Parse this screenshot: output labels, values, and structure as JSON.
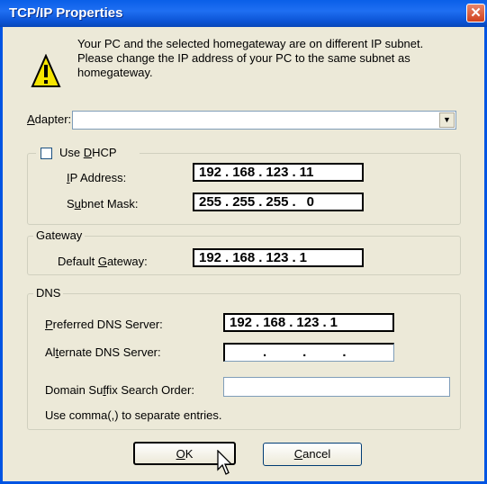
{
  "window": {
    "title": "TCP/IP Properties",
    "close_label": "✕"
  },
  "message": {
    "line1": "Your PC and the selected homegateway are on different IP subnet.",
    "line2": "Please change the IP address of your PC to the same subnet as",
    "line3": "homegateway."
  },
  "adapter": {
    "label_pre": "",
    "label_u": "A",
    "label_post": "dapter:",
    "value": ""
  },
  "dhcp": {
    "label_pre": "Use ",
    "label_u": "D",
    "label_post": "HCP",
    "checked": false,
    "ip_label_u": "I",
    "ip_label_post": "P Address:",
    "ip": {
      "o1": "192",
      "o2": "168",
      "o3": "123",
      "o4": "11"
    },
    "mask_label_pre": "S",
    "mask_label_u": "u",
    "mask_label_post": "bnet Mask:",
    "mask": {
      "o1": "255",
      "o2": "255",
      "o3": "255",
      "o4": "0"
    }
  },
  "gateway": {
    "legend": "Gateway",
    "label_pre": "Default ",
    "label_u": "G",
    "label_post": "ateway:",
    "ip": {
      "o1": "192",
      "o2": "168",
      "o3": "123",
      "o4": "1"
    }
  },
  "dns": {
    "legend": "DNS",
    "pref_label_u": "P",
    "pref_label_post": "referred DNS Server:",
    "pref": {
      "o1": "192",
      "o2": "168",
      "o3": "123",
      "o4": "1"
    },
    "alt_label_pre": "Al",
    "alt_label_u": "t",
    "alt_label_post": "ernate DNS Server:",
    "suffix_label_pre": "Domain Su",
    "suffix_label_u": "f",
    "suffix_label_post": "fix Search Order:",
    "suffix_value": "",
    "hint": "Use comma(,) to separate entries."
  },
  "buttons": {
    "ok_u": "O",
    "ok_post": "K",
    "cancel_u": "C",
    "cancel_post": "ancel"
  },
  "colors": {
    "title_bar": "#0a5fe8",
    "dialog_bg": "#ece9d8",
    "close_button": "#d0411d"
  }
}
